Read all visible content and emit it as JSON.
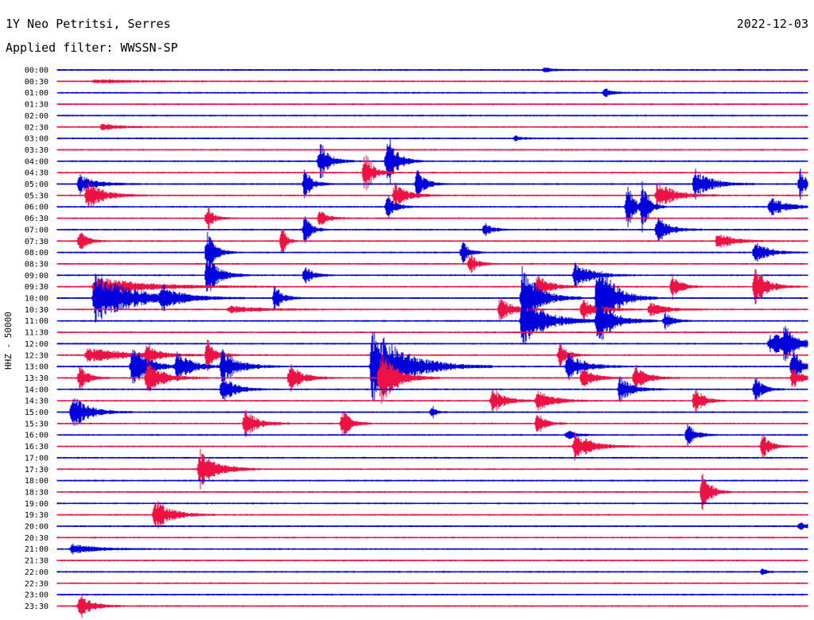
{
  "header": {
    "station": "1Y Neo Petritsi, Serres",
    "date": "2022-12-03",
    "filter": "Applied filter: WWSSN-SP"
  },
  "chart_data": {
    "type": "line",
    "title": "1Y Neo Petritsi, Serres",
    "ylabel": "HHZ - 50000",
    "trace_colors": [
      "#0000dd",
      "#ee1144"
    ],
    "row_labels": [
      "00:00",
      "00:30",
      "01:00",
      "01:30",
      "02:00",
      "02:30",
      "03:00",
      "03:30",
      "04:00",
      "04:30",
      "05:00",
      "05:30",
      "06:00",
      "06:30",
      "07:00",
      "07:30",
      "08:00",
      "08:30",
      "09:00",
      "09:30",
      "10:00",
      "10:30",
      "11:00",
      "11:30",
      "12:00",
      "12:30",
      "13:00",
      "13:30",
      "14:00",
      "14:30",
      "15:00",
      "15:30",
      "16:00",
      "16:30",
      "17:00",
      "17:30",
      "18:00",
      "18:30",
      "19:00",
      "19:30",
      "20:00",
      "20:30",
      "21:00",
      "21:30",
      "22:00",
      "22:30",
      "23:00",
      "23:30"
    ],
    "events": [
      {
        "row": 0,
        "x": 0.65,
        "amp": 0.15,
        "w": 0.01
      },
      {
        "row": 1,
        "x": 0.05,
        "amp": 0.1,
        "w": 0.05
      },
      {
        "row": 2,
        "x": 0.73,
        "amp": 0.3,
        "w": 0.01
      },
      {
        "row": 5,
        "x": 0.06,
        "amp": 0.2,
        "w": 0.02
      },
      {
        "row": 6,
        "x": 0.61,
        "amp": 0.15,
        "w": 0.01
      },
      {
        "row": 8,
        "x": 0.35,
        "amp": 1.2,
        "w": 0.012
      },
      {
        "row": 8,
        "x": 0.44,
        "amp": 1.8,
        "w": 0.012
      },
      {
        "row": 9,
        "x": 0.41,
        "amp": 1.3,
        "w": 0.01
      },
      {
        "row": 10,
        "x": 0.03,
        "amp": 0.6,
        "w": 0.02
      },
      {
        "row": 10,
        "x": 0.33,
        "amp": 0.9,
        "w": 0.01
      },
      {
        "row": 10,
        "x": 0.48,
        "amp": 1.0,
        "w": 0.01
      },
      {
        "row": 10,
        "x": 0.85,
        "amp": 0.9,
        "w": 0.02
      },
      {
        "row": 10,
        "x": 0.99,
        "amp": 1.0,
        "w": 0.008
      },
      {
        "row": 11,
        "x": 0.04,
        "amp": 0.9,
        "w": 0.02
      },
      {
        "row": 11,
        "x": 0.45,
        "amp": 0.8,
        "w": 0.015
      },
      {
        "row": 11,
        "x": 0.8,
        "amp": 0.9,
        "w": 0.02
      },
      {
        "row": 12,
        "x": 0.44,
        "amp": 0.7,
        "w": 0.01
      },
      {
        "row": 12,
        "x": 0.76,
        "amp": 1.5,
        "w": 0.008
      },
      {
        "row": 12,
        "x": 0.78,
        "amp": 1.6,
        "w": 0.008
      },
      {
        "row": 12,
        "x": 0.95,
        "amp": 0.6,
        "w": 0.02
      },
      {
        "row": 13,
        "x": 0.2,
        "amp": 0.8,
        "w": 0.008
      },
      {
        "row": 13,
        "x": 0.35,
        "amp": 0.5,
        "w": 0.01
      },
      {
        "row": 14,
        "x": 0.33,
        "amp": 0.9,
        "w": 0.008
      },
      {
        "row": 14,
        "x": 0.57,
        "amp": 0.4,
        "w": 0.01
      },
      {
        "row": 14,
        "x": 0.8,
        "amp": 0.8,
        "w": 0.015
      },
      {
        "row": 15,
        "x": 0.03,
        "amp": 0.6,
        "w": 0.01
      },
      {
        "row": 15,
        "x": 0.3,
        "amp": 1.0,
        "w": 0.005
      },
      {
        "row": 15,
        "x": 0.88,
        "amp": 0.5,
        "w": 0.02
      },
      {
        "row": 16,
        "x": 0.2,
        "amp": 1.3,
        "w": 0.01
      },
      {
        "row": 16,
        "x": 0.54,
        "amp": 0.8,
        "w": 0.008
      },
      {
        "row": 16,
        "x": 0.93,
        "amp": 0.8,
        "w": 0.015
      },
      {
        "row": 17,
        "x": 0.55,
        "amp": 0.6,
        "w": 0.01
      },
      {
        "row": 18,
        "x": 0.2,
        "amp": 1.2,
        "w": 0.015
      },
      {
        "row": 18,
        "x": 0.33,
        "amp": 0.6,
        "w": 0.01
      },
      {
        "row": 18,
        "x": 0.69,
        "amp": 0.8,
        "w": 0.02
      },
      {
        "row": 19,
        "x": 0.05,
        "amp": 0.6,
        "w": 0.06
      },
      {
        "row": 19,
        "x": 0.64,
        "amp": 0.8,
        "w": 0.015
      },
      {
        "row": 19,
        "x": 0.82,
        "amp": 0.8,
        "w": 0.01
      },
      {
        "row": 19,
        "x": 0.93,
        "amp": 1.2,
        "w": 0.015
      },
      {
        "row": 20,
        "x": 0.05,
        "amp": 1.4,
        "w": 0.05
      },
      {
        "row": 20,
        "x": 0.14,
        "amp": 0.6,
        "w": 0.02
      },
      {
        "row": 20,
        "x": 0.29,
        "amp": 0.8,
        "w": 0.01
      },
      {
        "row": 20,
        "x": 0.62,
        "amp": 2.0,
        "w": 0.02
      },
      {
        "row": 20,
        "x": 0.72,
        "amp": 2.5,
        "w": 0.02
      },
      {
        "row": 21,
        "x": 0.23,
        "amp": 0.2,
        "w": 0.04
      },
      {
        "row": 21,
        "x": 0.59,
        "amp": 0.8,
        "w": 0.015
      },
      {
        "row": 21,
        "x": 0.7,
        "amp": 0.6,
        "w": 0.02
      },
      {
        "row": 21,
        "x": 0.79,
        "amp": 0.4,
        "w": 0.02
      },
      {
        "row": 22,
        "x": 0.62,
        "amp": 1.5,
        "w": 0.03
      },
      {
        "row": 22,
        "x": 0.72,
        "amp": 1.5,
        "w": 0.02
      },
      {
        "row": 22,
        "x": 0.81,
        "amp": 0.5,
        "w": 0.01
      },
      {
        "row": 24,
        "x": 0.95,
        "amp": 0.6,
        "w": 0.04
      },
      {
        "row": 24,
        "x": 0.97,
        "amp": 1.0,
        "w": 0.008
      },
      {
        "row": 25,
        "x": 0.04,
        "amp": 0.4,
        "w": 0.06
      },
      {
        "row": 25,
        "x": 0.12,
        "amp": 0.7,
        "w": 0.01
      },
      {
        "row": 25,
        "x": 0.2,
        "amp": 1.0,
        "w": 0.01
      },
      {
        "row": 25,
        "x": 0.67,
        "amp": 0.7,
        "w": 0.01
      },
      {
        "row": 26,
        "x": 0.1,
        "amp": 1.2,
        "w": 0.02
      },
      {
        "row": 26,
        "x": 0.16,
        "amp": 0.8,
        "w": 0.02
      },
      {
        "row": 26,
        "x": 0.22,
        "amp": 1.0,
        "w": 0.02
      },
      {
        "row": 26,
        "x": 0.42,
        "amp": 2.4,
        "w": 0.04
      },
      {
        "row": 26,
        "x": 0.68,
        "amp": 0.9,
        "w": 0.02
      },
      {
        "row": 26,
        "x": 0.98,
        "amp": 1.2,
        "w": 0.01
      },
      {
        "row": 27,
        "x": 0.03,
        "amp": 0.8,
        "w": 0.01
      },
      {
        "row": 27,
        "x": 0.12,
        "amp": 1.0,
        "w": 0.02
      },
      {
        "row": 27,
        "x": 0.31,
        "amp": 0.9,
        "w": 0.015
      },
      {
        "row": 27,
        "x": 0.43,
        "amp": 1.8,
        "w": 0.02
      },
      {
        "row": 27,
        "x": 0.7,
        "amp": 0.6,
        "w": 0.015
      },
      {
        "row": 27,
        "x": 0.77,
        "amp": 0.8,
        "w": 0.015
      },
      {
        "row": 27,
        "x": 0.98,
        "amp": 0.7,
        "w": 0.01
      },
      {
        "row": 28,
        "x": 0.22,
        "amp": 0.9,
        "w": 0.015
      },
      {
        "row": 28,
        "x": 0.75,
        "amp": 0.8,
        "w": 0.015
      },
      {
        "row": 28,
        "x": 0.93,
        "amp": 0.8,
        "w": 0.01
      },
      {
        "row": 29,
        "x": 0.58,
        "amp": 0.8,
        "w": 0.015
      },
      {
        "row": 29,
        "x": 0.64,
        "amp": 0.6,
        "w": 0.02
      },
      {
        "row": 29,
        "x": 0.85,
        "amp": 0.9,
        "w": 0.01
      },
      {
        "row": 30,
        "x": 0.02,
        "amp": 1.0,
        "w": 0.02
      },
      {
        "row": 30,
        "x": 0.5,
        "amp": 0.4,
        "w": 0.005
      },
      {
        "row": 31,
        "x": 0.25,
        "amp": 0.9,
        "w": 0.015
      },
      {
        "row": 31,
        "x": 0.38,
        "amp": 0.9,
        "w": 0.01
      },
      {
        "row": 31,
        "x": 0.64,
        "amp": 0.7,
        "w": 0.01
      },
      {
        "row": 32,
        "x": 0.68,
        "amp": 0.3,
        "w": 0.01
      },
      {
        "row": 32,
        "x": 0.84,
        "amp": 0.7,
        "w": 0.01
      },
      {
        "row": 33,
        "x": 0.69,
        "amp": 0.9,
        "w": 0.02
      },
      {
        "row": 33,
        "x": 0.94,
        "amp": 0.7,
        "w": 0.01
      },
      {
        "row": 35,
        "x": 0.19,
        "amp": 1.2,
        "w": 0.02
      },
      {
        "row": 37,
        "x": 0.86,
        "amp": 1.3,
        "w": 0.01
      },
      {
        "row": 39,
        "x": 0.13,
        "amp": 1.0,
        "w": 0.02
      },
      {
        "row": 40,
        "x": 0.99,
        "amp": 0.3,
        "w": 0.01
      },
      {
        "row": 42,
        "x": 0.02,
        "amp": 0.3,
        "w": 0.03
      },
      {
        "row": 44,
        "x": 0.94,
        "amp": 0.2,
        "w": 0.005
      },
      {
        "row": 47,
        "x": 0.03,
        "amp": 0.8,
        "w": 0.015
      }
    ]
  }
}
